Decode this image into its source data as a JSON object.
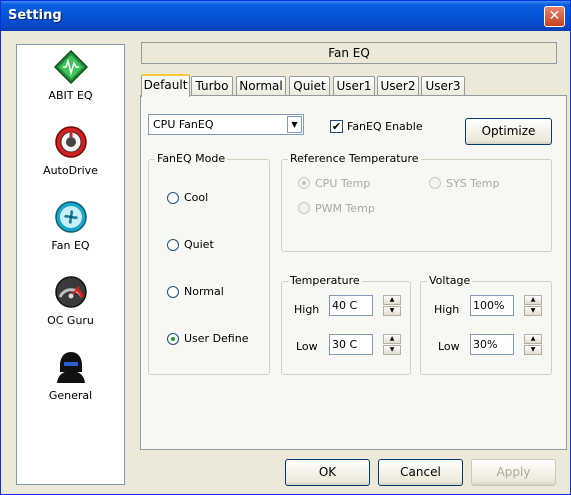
{
  "window": {
    "title": "Setting",
    "close_glyph": "✕"
  },
  "sidebar": {
    "items": [
      {
        "label": "ABIT EQ",
        "icon": "abit-eq-icon"
      },
      {
        "label": "AutoDrive",
        "icon": "autodrive-icon"
      },
      {
        "label": "Fan EQ",
        "icon": "fan-eq-icon"
      },
      {
        "label": "OC Guru",
        "icon": "oc-guru-icon"
      },
      {
        "label": "General",
        "icon": "general-icon"
      }
    ]
  },
  "panel": {
    "title": "Fan EQ"
  },
  "tabs": [
    "Default",
    "Turbo",
    "Normal",
    "Quiet",
    "User1",
    "User2",
    "User3"
  ],
  "active_tab": "Default",
  "fan_select": {
    "value": "CPU FanEQ",
    "arrow": "▼"
  },
  "fan_eq_enable": {
    "label": "FanEQ Enable",
    "checked": true,
    "mark": "✔"
  },
  "optimize_button": "Optimize",
  "fan_mode": {
    "title": "FanEQ Mode",
    "options": [
      {
        "label": "Cool",
        "selected": false
      },
      {
        "label": "Quiet",
        "selected": false
      },
      {
        "label": "Normal",
        "selected": false
      },
      {
        "label": "User Define",
        "selected": true
      }
    ]
  },
  "reference_temperature": {
    "title": "Reference Temperature",
    "options": [
      {
        "label": "CPU Temp",
        "selected": true,
        "enabled": false
      },
      {
        "label": "SYS Temp",
        "selected": false,
        "enabled": false
      },
      {
        "label": "PWM Temp",
        "selected": false,
        "enabled": false
      }
    ]
  },
  "temperature": {
    "title": "Temperature",
    "high_label": "High",
    "high_value": "40 C",
    "low_label": "Low",
    "low_value": "30 C"
  },
  "voltage": {
    "title": "Voltage",
    "high_label": "High",
    "high_value": "100%",
    "low_label": "Low",
    "low_value": "30%"
  },
  "spin_glyphs": {
    "up": "▲",
    "down": "▼"
  },
  "footer": {
    "ok": "OK",
    "cancel": "Cancel",
    "apply": "Apply",
    "apply_enabled": false
  },
  "colors": {
    "titlebar": "#0453d6",
    "accent_tab": "#ffc83c",
    "radio_dot": "#21a121"
  }
}
